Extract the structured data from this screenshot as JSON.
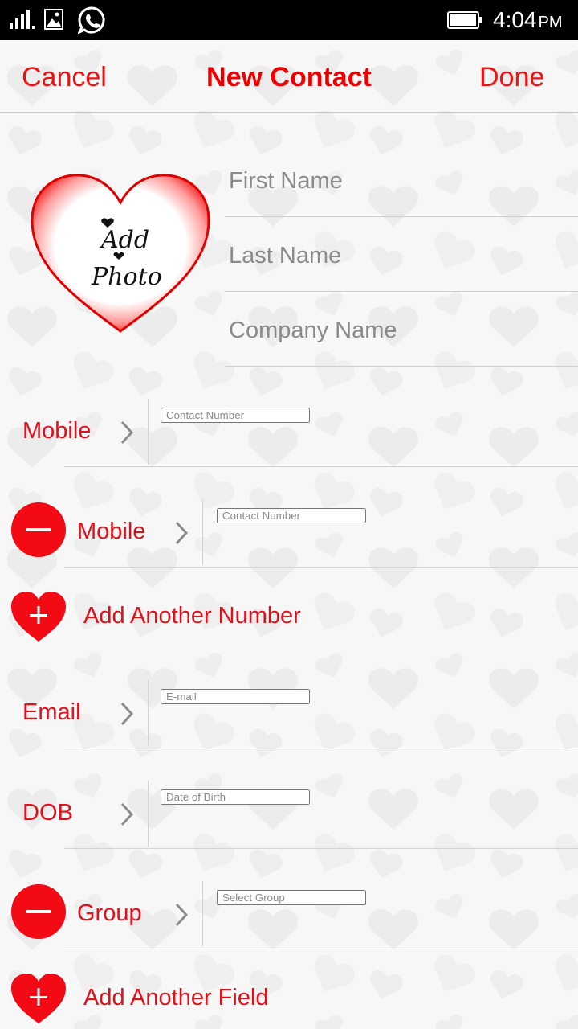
{
  "status_bar": {
    "time": "4:04",
    "ampm": "PM"
  },
  "header": {
    "cancel_label": "Cancel",
    "title": "New Contact",
    "done_label": "Done"
  },
  "photo": {
    "line1": "Add",
    "line2": "Photo"
  },
  "name_fields": {
    "first_name_placeholder": "First Name",
    "last_name_placeholder": "Last Name",
    "company_placeholder": "Company Name"
  },
  "rows": {
    "mobile1": {
      "label": "Mobile",
      "placeholder": "Contact Number"
    },
    "mobile2": {
      "label": "Mobile",
      "placeholder": "Contact Number"
    },
    "add_number_label": "Add Another Number",
    "email": {
      "label": "Email",
      "placeholder": "E-mail"
    },
    "dob": {
      "label": "DOB",
      "placeholder": "Date of Birth"
    },
    "group": {
      "label": "Group",
      "placeholder": "Select Group"
    },
    "add_field_label": "Add Another Field"
  },
  "colors": {
    "accent": "#ee1111",
    "background": "#f7f7f7"
  },
  "icons": {
    "signal": "signal-icon",
    "gallery": "gallery-icon",
    "whatsapp": "whatsapp-icon",
    "battery": "battery-icon",
    "chevron": "chevron-right-icon",
    "remove": "remove-circle-icon",
    "add": "heart-plus-icon"
  }
}
